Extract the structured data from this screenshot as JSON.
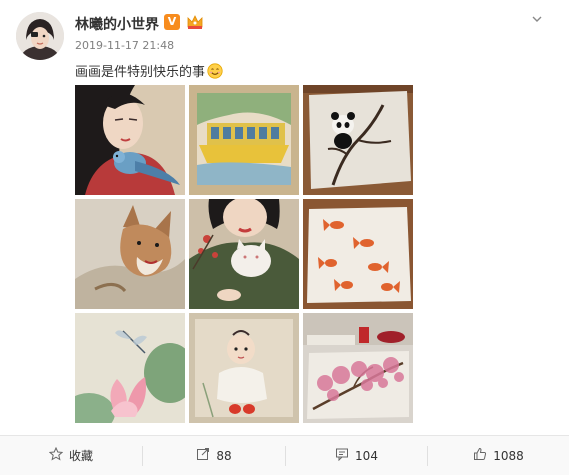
{
  "post": {
    "username": "林曦的小世界",
    "verified_badge": "V",
    "timestamp": "2019-11-17 21:48",
    "text": "画画是件特别快乐的事",
    "emoji": "smiley-emoji",
    "photos": [
      {
        "name": "photo-girl-with-parrot"
      },
      {
        "name": "photo-yellow-boat"
      },
      {
        "name": "photo-panda-on-branch"
      },
      {
        "name": "photo-fox"
      },
      {
        "name": "photo-girl-with-white-cat"
      },
      {
        "name": "photo-goldfish"
      },
      {
        "name": "photo-lotus-dragonfly"
      },
      {
        "name": "photo-baby-portrait"
      },
      {
        "name": "photo-plum-blossom"
      }
    ]
  },
  "footer": {
    "favorite_label": "收藏",
    "repost_count": "88",
    "comment_count": "104",
    "like_count": "1088"
  },
  "icons": {
    "more": "chevron-down-icon",
    "favorite": "star-icon",
    "repost": "repost-icon",
    "comment": "comment-icon",
    "like": "thumbs-up-icon"
  },
  "colors": {
    "username": "#333333",
    "timestamp": "#808080",
    "badge": "#f78c1e",
    "footer_bg": "#f9f9f9"
  }
}
